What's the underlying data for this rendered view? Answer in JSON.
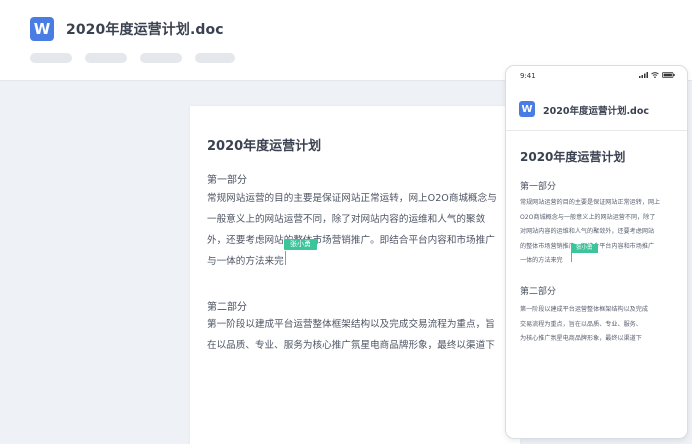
{
  "desktop": {
    "app_logo": "W",
    "doc_title": "2020年度运营计划.doc",
    "toolbar_placeholders": 4,
    "document": {
      "title": "2020年度运营计划",
      "sections": [
        {
          "heading": "第一部分",
          "lines": [
            "常规网站运营的目的主要是保证网站正常运转，网上O2O商城概念与",
            "一般意义上的网站运营不同，除了对网站内容的运维和人气的聚敛",
            "外，还要考虑网站的整体市场营销推广。即结合平台内容和市场推广",
            "与一体的方法来完"
          ]
        },
        {
          "heading": "第二部分",
          "lines": [
            "第一阶段以建成平台运营整体框架结构以及完成交易流程为重点，旨",
            "在以品质、专业、服务为核心推广氛星电商品牌形象，最终以渠道下"
          ]
        }
      ],
      "collaborator": "张小勇"
    }
  },
  "mobile": {
    "status_time": "9:41",
    "app_logo": "W",
    "doc_title": "2020年度运营计划.doc",
    "document": {
      "title": "2020年度运营计划",
      "sections": [
        {
          "heading": "第一部分",
          "lines": [
            "常规网站运营的目的主要是保证网站正常运转，网上",
            "O2O商城概念与一般意义上的网站运营不同，除了",
            "对网站内容的运维和人气的聚敛外，还要考虑网站",
            "的整体市场营销推广。即结合平台内容和市场推广",
            "一体的方法来完"
          ]
        },
        {
          "heading": "第二部分",
          "lines": [
            "第一阶段以建成平台运营整体框架结构以及完成",
            "交易流程为重点，旨在以品质、专业、服务、",
            "为核心推广氛星电商品牌形象，最终以渠道下"
          ]
        }
      ],
      "collaborator": "张小勇"
    }
  },
  "colors": {
    "brand_blue": "#4a7de4",
    "collab_green": "#3cc59a",
    "workspace_bg": "#eef1f5"
  }
}
